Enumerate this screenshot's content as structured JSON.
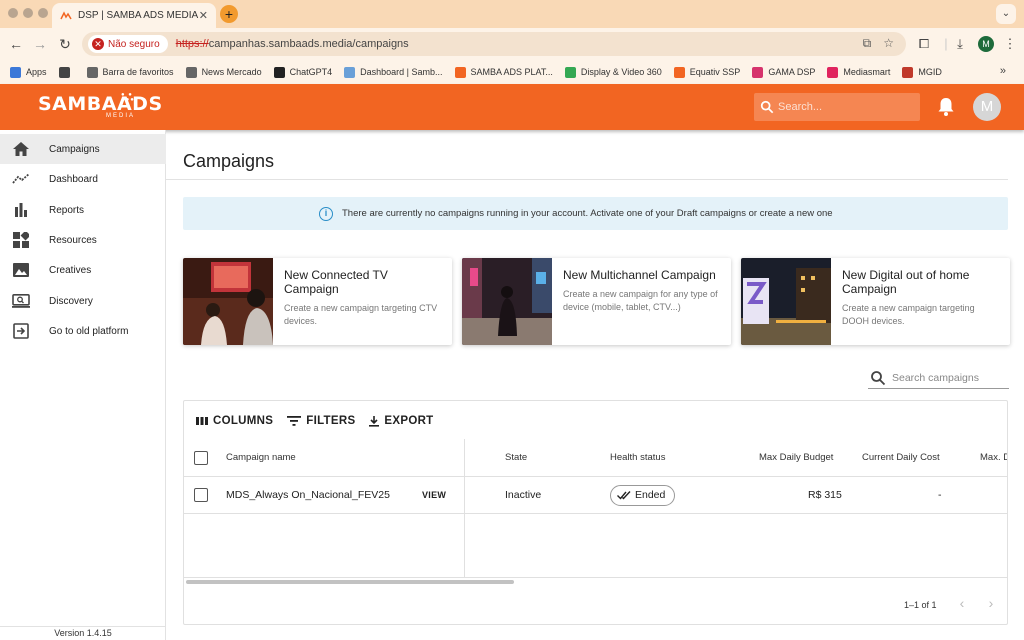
{
  "browser": {
    "tab_title": "DSP | SAMBA ADS MEDIA",
    "tab_close": "✕",
    "new_tab": "+",
    "insecure_label": "Não seguro",
    "url_scheme": "https://",
    "url_rest": "campanhas.sambaads.media/campaigns",
    "profile_initial": "M",
    "bookmarks": [
      {
        "label": "Apps",
        "icon": "apps-icon",
        "color": "#3c78d8"
      },
      {
        "label": "",
        "icon": "grid-icon",
        "color": "#444444"
      },
      {
        "label": "Barra de favoritos",
        "icon": "folder-icon",
        "color": "#666666"
      },
      {
        "label": "News Mercado",
        "icon": "folder-icon",
        "color": "#666666"
      },
      {
        "label": "ChatGPT4",
        "icon": "chatgpt-icon",
        "color": "#222222"
      },
      {
        "label": "Dashboard | Samb...",
        "icon": "samba-icon",
        "color": "#6aa0d8"
      },
      {
        "label": "SAMBA ADS PLAT...",
        "icon": "samba-icon",
        "color": "#f26522"
      },
      {
        "label": "Display & Video 360",
        "icon": "dv360-icon",
        "color": "#34a853"
      },
      {
        "label": "Equativ SSP",
        "icon": "equativ-icon",
        "color": "#f26522"
      },
      {
        "label": "GAMA DSP",
        "icon": "gama-icon",
        "color": "#d6336c"
      },
      {
        "label": "Mediasmart",
        "icon": "mediasmart-icon",
        "color": "#e0245e"
      },
      {
        "label": "MGID",
        "icon": "mgid-icon",
        "color": "#c0392b"
      }
    ],
    "more": "»"
  },
  "app": {
    "logo_main": "SAMBAADS",
    "logo_sub": "MEDIA",
    "search_placeholder": "Search...",
    "user_initial": "M",
    "brand_color": "#f26522"
  },
  "sidebar": {
    "items": [
      {
        "label": "Campaigns",
        "icon": "home-icon",
        "active": true
      },
      {
        "label": "Dashboard",
        "icon": "trend-icon",
        "active": false
      },
      {
        "label": "Reports",
        "icon": "bar-chart-icon",
        "active": false
      },
      {
        "label": "Resources",
        "icon": "widgets-icon",
        "active": false
      },
      {
        "label": "Creatives",
        "icon": "image-icon",
        "active": false
      },
      {
        "label": "Discovery",
        "icon": "screen-search-icon",
        "active": false
      },
      {
        "label": "Go to old platform",
        "icon": "exit-icon",
        "active": false
      }
    ],
    "version": "Version 1.4.15"
  },
  "main": {
    "title": "Campaigns",
    "info_text": "There are currently no campaigns running in your account. Activate one of your Draft campaigns or create a new one",
    "cards": [
      {
        "title": "New Connected TV Campaign",
        "description": "Create a new campaign targeting CTV devices."
      },
      {
        "title": "New Multichannel Campaign",
        "description": "Create a new campaign for any type of device (mobile, tablet, CTV...)"
      },
      {
        "title": "New Digital out of home Campaign",
        "description": "Create a new campaign targeting DOOH devices."
      }
    ],
    "search_placeholder": "Search campaigns"
  },
  "grid": {
    "toolbar": {
      "columns": "COLUMNS",
      "filters": "FILTERS",
      "export": "EXPORT"
    },
    "headers": {
      "name": "Campaign name",
      "state": "State",
      "health": "Health status",
      "max_budget": "Max Daily Budget",
      "current_cost": "Current Daily Cost",
      "max_d": "Max. D"
    },
    "rows": [
      {
        "name": "MDS_Always On_Nacional_FEV25",
        "view": "VIEW",
        "state": "Inactive",
        "health": "Ended",
        "max_budget": "R$ 315",
        "current_cost": "-"
      }
    ],
    "pagination": "1–1 of 1",
    "prev": "‹",
    "next": "›"
  }
}
